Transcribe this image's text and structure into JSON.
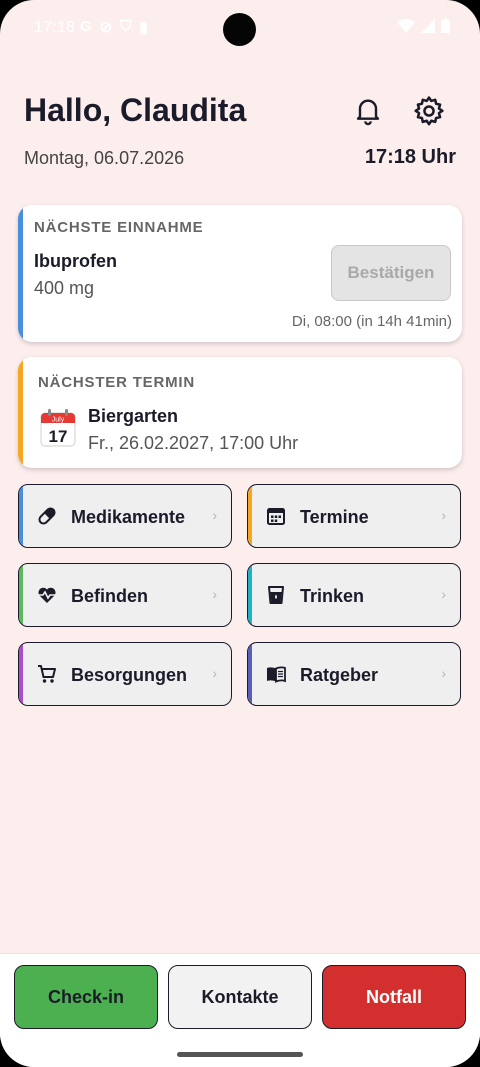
{
  "status_bar": {
    "time": "17:18",
    "icons_left": [
      "G",
      "⊘",
      "⛉",
      "▮"
    ]
  },
  "header": {
    "greeting": "Hallo, Claudita",
    "date": "Montag, 06.07.2026",
    "time": "17:18 Uhr",
    "icons": [
      "bell-icon",
      "gear-icon"
    ]
  },
  "next_intake": {
    "label": "NÄCHSTE EINNAHME",
    "medication": "Ibuprofen",
    "dose": "400 mg",
    "confirm_label": "Bestätigen",
    "schedule": "Di, 08:00  (in 14h 41min)",
    "accent_color": "#4a8fd9"
  },
  "next_appointment": {
    "label": "NÄCHSTER TERMIN",
    "title": "Biergarten",
    "datetime": "Fr., 26.02.2027, 17:00 Uhr",
    "calendar_month": "July",
    "calendar_day": "17",
    "accent_color": "#f5a623"
  },
  "tiles": [
    {
      "label": "Medikamente",
      "icon": "pill-icon",
      "accent": "#4a8fd9",
      "chevron": "›"
    },
    {
      "label": "Termine",
      "icon": "calendar-icon",
      "accent": "#f5a623",
      "chevron": "›"
    },
    {
      "label": "Befinden",
      "icon": "heartbeat-icon",
      "accent": "#5cb85c",
      "chevron": "›"
    },
    {
      "label": "Trinken",
      "icon": "cup-icon",
      "accent": "#1fb3c7",
      "chevron": "›"
    },
    {
      "label": "Besorgungen",
      "icon": "cart-icon",
      "accent": "#a84fc9",
      "chevron": "›"
    },
    {
      "label": "Ratgeber",
      "icon": "book-icon",
      "accent": "#5a5fb5",
      "chevron": "›"
    }
  ],
  "bottom_bar": {
    "checkin_label": "Check-in",
    "contacts_label": "Kontakte",
    "emergency_label": "Notfall",
    "checkin_color": "#4caf50",
    "emergency_color": "#d32f2f"
  }
}
